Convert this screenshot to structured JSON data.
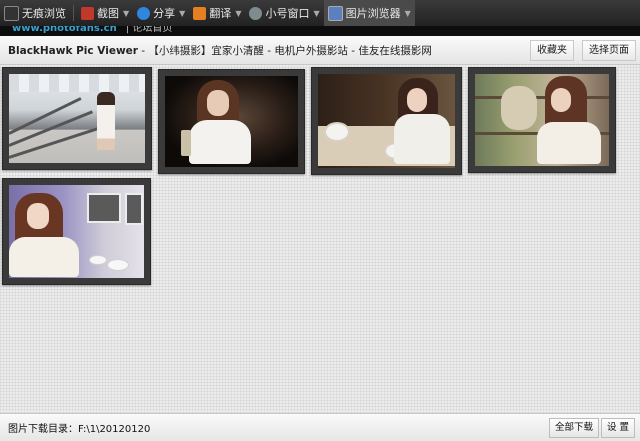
{
  "toolbar": {
    "items": [
      {
        "label": "无痕浏览",
        "icon": "incognito-icon"
      },
      {
        "label": "截图",
        "icon": "screenshot-icon"
      },
      {
        "label": "分享",
        "icon": "share-icon"
      },
      {
        "label": "翻译",
        "icon": "translate-icon"
      },
      {
        "label": "小号窗口",
        "icon": "alt-window-icon"
      },
      {
        "label": "图片浏览器",
        "icon": "image-viewer-icon"
      }
    ]
  },
  "page_strip": {
    "url": "www.photofans.cn",
    "text": "| 论坛首页"
  },
  "viewer": {
    "app_name": "BlackHawk Pic Viewer",
    "page_title": " - 【小纬摄影】宜家小清醒 - 电机户外摄影站 - 佳友在线摄影网",
    "favorites_label": "收藏夹",
    "select_page_label": "选择页面"
  },
  "thumbnails": [
    {
      "subject": "subway"
    },
    {
      "subject": "dark-portrait"
    },
    {
      "subject": "cafe"
    },
    {
      "subject": "shop"
    },
    {
      "subject": "purple-room"
    }
  ],
  "bottom": {
    "download_dir_label": "图片下载目录：",
    "download_dir_value": "F:\\1\\20120120",
    "download_all_label": "全部下载",
    "settings_label": "设 置"
  },
  "colors": {
    "toolbar_bg": "#2a2a2a",
    "gallery_bg": "#ececec",
    "thumb_frame": "#3a3a3a"
  }
}
